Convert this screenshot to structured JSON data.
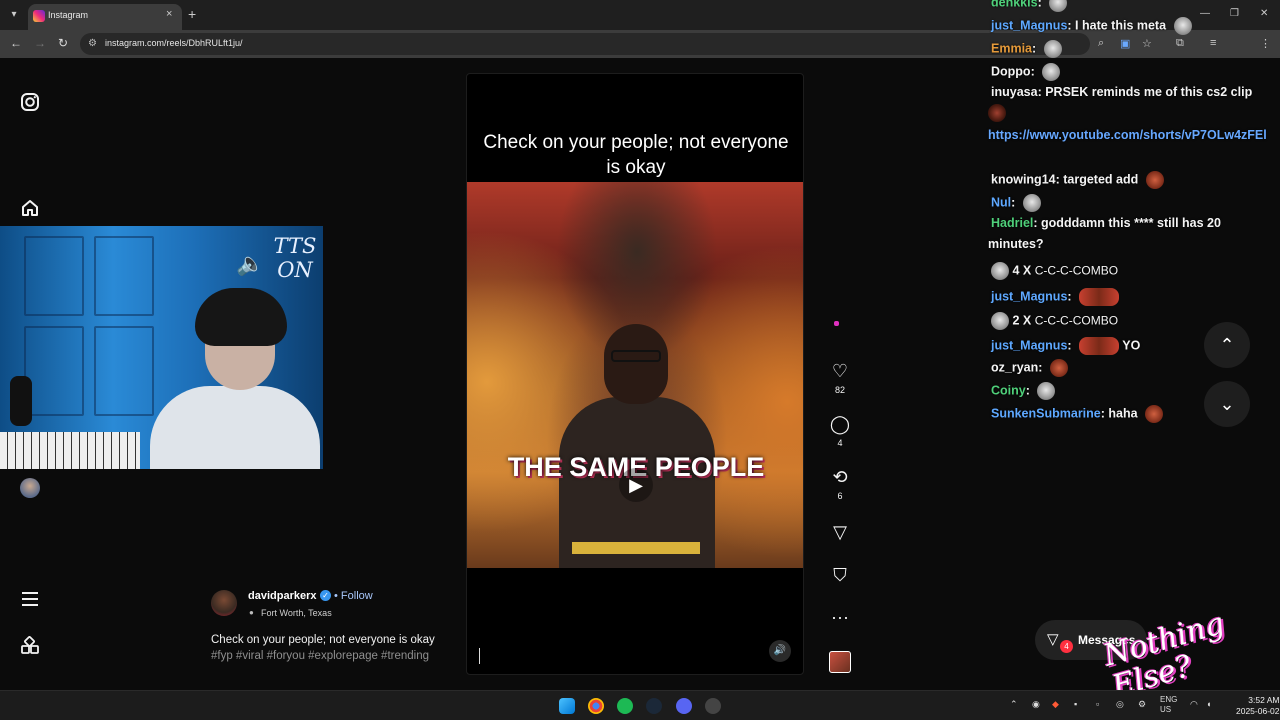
{
  "browser": {
    "tab_title": "Instagram",
    "tab_close": "×",
    "new_tab": "+",
    "url": "instagram.com/reels/DbhRULft1ju/",
    "win_minimize": "—",
    "win_restore": "❐",
    "win_close": "✕"
  },
  "reel": {
    "caption_overlay": "Check on your people; not everyone is okay",
    "video_text": "THE SAME PEOPLE",
    "author": "davidparkerx",
    "follow_label": "Follow",
    "location": "Fort Worth, Texas",
    "description": "Check on your people; not everyone is okay",
    "hashtags": "#fyp #viral #foryou #explorepage #trending",
    "likes": "82",
    "comments": "4",
    "reposts": "6"
  },
  "messages": {
    "label": "Messages",
    "badge": "4"
  },
  "stream": {
    "tts_label": "TTS ON"
  },
  "chat": {
    "lines": [
      {
        "user": "denkkis",
        "color": "#4fd07a",
        "text": ""
      },
      {
        "user": "just_Magnus",
        "color": "#5ea8ff",
        "text": "I hate this meta"
      },
      {
        "user": "Emmia",
        "color": "#e59a3a",
        "text": ""
      },
      {
        "user": "Doppo",
        "color": "#f4f4f4",
        "text": ""
      },
      {
        "user": "inuyasa",
        "color": "#f4f4f4",
        "text": "PRSEK reminds me of this cs2 clip"
      },
      {
        "user": "knowing14",
        "color": "#f4f4f4",
        "text": "targeted add"
      },
      {
        "user": "Nul",
        "color": "#5ea8ff",
        "text": ""
      },
      {
        "user": "Hadriel",
        "color": "#4fd07a",
        "text": "godddamn this **** still has 20"
      },
      {
        "user": "just_Magnus",
        "color": "#5ea8ff",
        "text": ""
      },
      {
        "user": "just_Magnus",
        "color": "#5ea8ff",
        "text": "YO"
      },
      {
        "user": "oz_ryan",
        "color": "#f4f4f4",
        "text": ""
      },
      {
        "user": "Coiny",
        "color": "#4fd07a",
        "text": ""
      },
      {
        "user": "SunkenSubmarine",
        "color": "#5ea8ff",
        "text": "haha"
      }
    ],
    "link": "https://www.youtube.com/shorts/vP7OLw4zFEl",
    "hadriel_cont": "minutes?",
    "combo1_count": "4 X",
    "combo2_count": "2 X",
    "combo_label": "C-C-C-COMBO"
  },
  "watermark": "Nothing Else?",
  "taskbar": {
    "lang": "ENG",
    "region": "US",
    "time": "3:52 AM",
    "date": "2025-06-02"
  }
}
